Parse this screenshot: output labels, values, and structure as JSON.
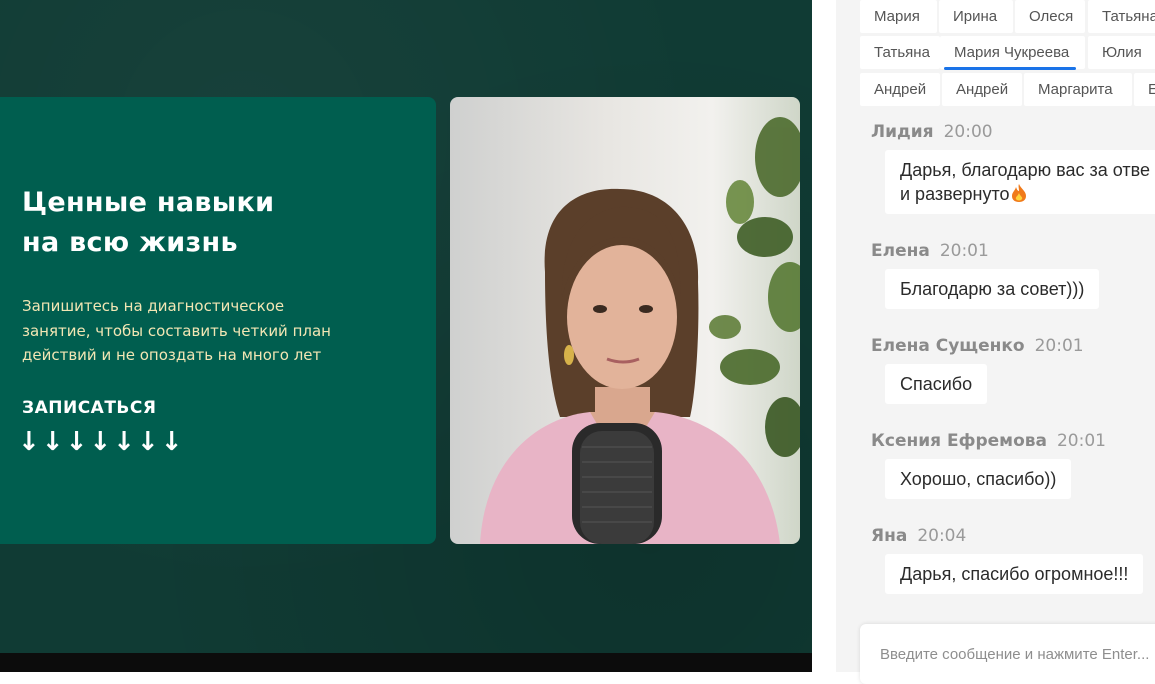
{
  "slide": {
    "title_line1": "Ценные навыки",
    "title_line2": "на всю жизнь",
    "subtitle_line1": "Запишитесь на диагностическое",
    "subtitle_line2": "занятие, чтобы составить четкий план",
    "subtitle_line3": "действий и не опоздать на много лет",
    "cta": "ЗАПИСАТЬСЯ",
    "arrows": "↓↓↓↓↓↓↓"
  },
  "participants": [
    {
      "name": "Мария"
    },
    {
      "name": "Ирина"
    },
    {
      "name": "Олеся"
    },
    {
      "name": "Татьяна"
    },
    {
      "name": "Татьяна"
    },
    {
      "name": "Мария Чукреева",
      "active": true
    },
    {
      "name": "Юлия"
    },
    {
      "name": "Андрей"
    },
    {
      "name": "Андрей"
    },
    {
      "name": "Маргарита"
    },
    {
      "name": "Е"
    }
  ],
  "messages": [
    {
      "author": "Лидия",
      "time": "20:00",
      "text_line1": "Дарья, благодарю вас за отве",
      "text_line2": "и развернуто",
      "emoji": "fire-icon"
    },
    {
      "author": "Елена",
      "time": "20:01",
      "text": "Благодарю за совет)))"
    },
    {
      "author": "Елена Сущенко",
      "time": "20:01",
      "text": "Спасибо"
    },
    {
      "author": "Ксения Ефремова",
      "time": "20:01",
      "text": "Хорошо, спасибо))"
    },
    {
      "author": "Яна",
      "time": "20:04",
      "text": "Дарья, спасибо огромное!!!"
    }
  ],
  "input": {
    "placeholder": "Введите сообщение и нажмите Enter...",
    "value": ""
  },
  "colors": {
    "stage_bg": "#103b34",
    "slide_bg": "#005e4f",
    "slide_subtitle": "#f2e6b4",
    "chip_underline": "#1a73e8",
    "chat_bg": "#f4f4f4"
  }
}
